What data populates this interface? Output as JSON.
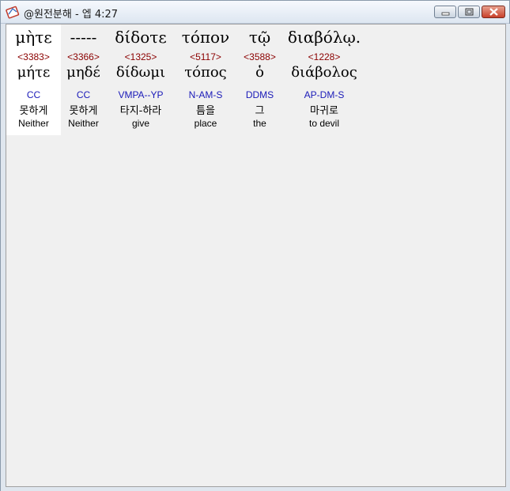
{
  "window": {
    "title": "@원전분해 - 엡 4:27",
    "controls": [
      "minimize",
      "maximize",
      "close"
    ]
  },
  "words": [
    {
      "greek": "μὴτε",
      "strong": "<3383>",
      "lemma": "μήτε",
      "parse": "CC",
      "korean": "못하게",
      "english": "Neither",
      "selected": true
    },
    {
      "greek": "-----",
      "strong": "<3366>",
      "lemma": "μηδέ",
      "parse": "CC",
      "korean": "못하게",
      "english": "Neither",
      "selected": false
    },
    {
      "greek": "δίδοτε",
      "strong": "<1325>",
      "lemma": "δίδωμι",
      "parse": "VMPA--YP",
      "korean": "타지-하라",
      "english": "give",
      "selected": false
    },
    {
      "greek": "τόπον",
      "strong": "<5117>",
      "lemma": "τόπος",
      "parse": "N-AM-S",
      "korean": "틈을",
      "english": "place",
      "selected": false
    },
    {
      "greek": "τῷ",
      "strong": "<3588>",
      "lemma": "ὁ",
      "parse": "DDMS",
      "korean": "그",
      "english": "the",
      "selected": false
    },
    {
      "greek": "διαβόλῳ.",
      "strong": "<1228>",
      "lemma": "διάβολος",
      "parse": "AP-DM-S",
      "korean": "마귀로",
      "english": "to devil",
      "selected": false
    }
  ],
  "colors": {
    "strong_number": "#8b0000",
    "parsing": "#1a1ab8",
    "selected_background": "#ffffff"
  }
}
